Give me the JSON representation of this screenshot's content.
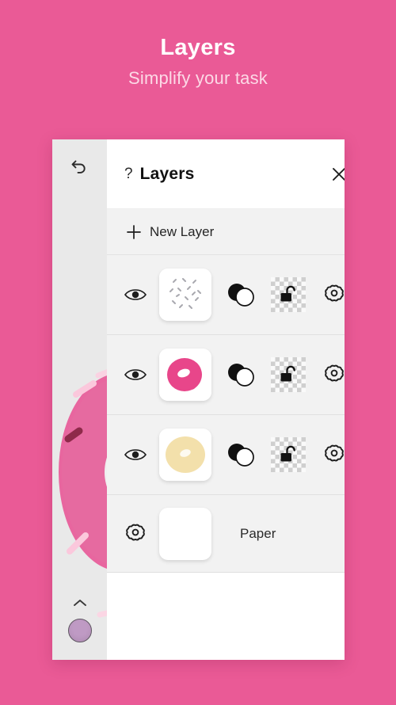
{
  "promo": {
    "title": "Layers",
    "subtitle": "Simplify your task",
    "background_color": "#ea5a96",
    "title_color": "#ffffff",
    "subtitle_color": "#fcd9e6"
  },
  "rail": {
    "undo_icon": "undo-arrow-icon",
    "expand_icon": "chevron-up-icon",
    "color_swatch": "#bf9ac4"
  },
  "panel": {
    "help_symbol": "?",
    "title": "Layers",
    "close_icon": "close-x-icon",
    "new_layer": {
      "label": "New Layer",
      "plus_icon": "plus-icon"
    },
    "layers": [
      {
        "name": "sprinkles-layer",
        "visible": true,
        "visibility_icon": "eye-icon",
        "thumbnail": "sprinkles-thumbnail",
        "blend_icon": "opacity-circles-icon",
        "lock_icon": "unlock-icon",
        "locked": false,
        "settings_icon": "gear-icon",
        "thumb_colors": {
          "marks": "#8f8f96",
          "base": "#ffffff"
        }
      },
      {
        "name": "icing-layer",
        "visible": true,
        "visibility_icon": "eye-icon",
        "thumbnail": "pink-donut-thumbnail",
        "blend_icon": "opacity-circles-icon",
        "lock_icon": "unlock-icon",
        "locked": false,
        "settings_icon": "gear-icon",
        "thumb_colors": {
          "icing": "#e8468a",
          "hole": "#ffffff",
          "base": "#ffffff"
        }
      },
      {
        "name": "dough-layer",
        "visible": true,
        "visibility_icon": "eye-icon",
        "thumbnail": "cream-donut-thumbnail",
        "blend_icon": "opacity-circles-icon",
        "lock_icon": "unlock-icon",
        "locked": false,
        "settings_icon": "gear-icon",
        "thumb_colors": {
          "dough": "#f3e0ab",
          "hole": "#ffffff",
          "base": "#ffffff"
        }
      }
    ],
    "paper": {
      "label": "Paper",
      "settings_icon": "gear-icon",
      "thumbnail": "white-paper-thumbnail",
      "color": "#ffffff"
    }
  },
  "canvas": {
    "artwork": "pink-donut-with-sprinkles",
    "icing_color": "#e8669f",
    "sprinkle_light": "#fbc8dc",
    "sprinkle_dark": "#8e2a4a"
  }
}
